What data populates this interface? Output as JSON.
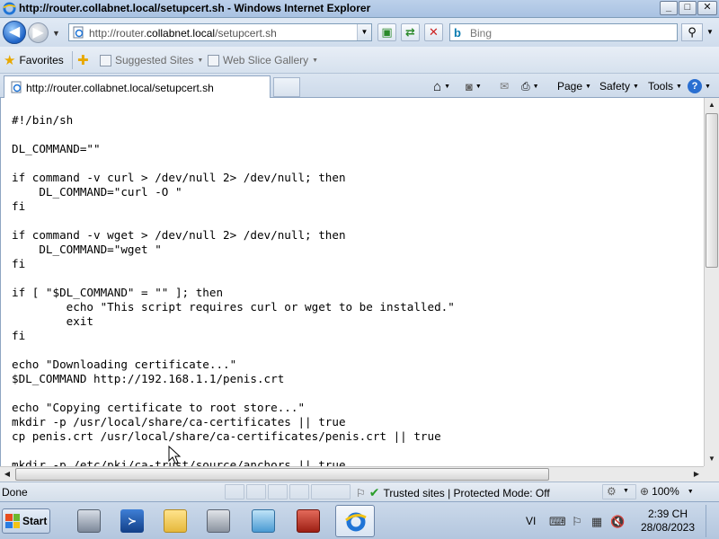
{
  "window": {
    "title": "http://router.collabnet.local/setupcert.sh - Windows Internet Explorer",
    "controls": {
      "minimize": "_",
      "maximize": "□",
      "close": "✕"
    }
  },
  "navigation": {
    "address_prefix": "http://router.",
    "address_domain": "collabnet.local",
    "address_suffix": "/setupcert.sh",
    "search_placeholder": "Bing"
  },
  "favorites_bar": {
    "favorites_label": "Favorites",
    "links": [
      {
        "label": "Suggested Sites"
      },
      {
        "label": "Web Slice Gallery"
      }
    ]
  },
  "tabs": [
    {
      "label": "http://router.collabnet.local/setupcert.sh",
      "active": true
    }
  ],
  "command_bar": {
    "page": "Page",
    "safety": "Safety",
    "tools": "Tools"
  },
  "document": {
    "lines": [
      "#!/bin/sh",
      "",
      "DL_COMMAND=\"\"",
      "",
      "if command -v curl > /dev/null 2> /dev/null; then",
      "    DL_COMMAND=\"curl -O \"",
      "fi",
      "",
      "if command -v wget > /dev/null 2> /dev/null; then",
      "    DL_COMMAND=\"wget \"",
      "fi",
      "",
      "if [ \"$DL_COMMAND\" = \"\" ]; then",
      "        echo \"This script requires curl or wget to be installed.\"",
      "        exit",
      "fi",
      "",
      "echo \"Downloading certificate...\"",
      "$DL_COMMAND http://192.168.1.1/penis.crt",
      "",
      "echo \"Copying certificate to root store...\"",
      "mkdir -p /usr/local/share/ca-certificates || true",
      "cp penis.crt /usr/local/share/ca-certificates/penis.crt || true",
      "",
      "mkdir -p /etc/pki/ca-trust/source/anchors || true"
    ]
  },
  "status_bar": {
    "status": "Done",
    "zone": "Trusted sites | Protected Mode: Off",
    "zoom": "100%"
  },
  "taskbar": {
    "start_label": "Start",
    "language": "VI",
    "time": "2:39 CH",
    "date": "28/08/2023",
    "apps": [
      {
        "icon": "server-manager-icon"
      },
      {
        "icon": "powershell-icon"
      },
      {
        "icon": "explorer-folder-icon"
      },
      {
        "icon": "admin-tools-icon"
      },
      {
        "icon": "control-panel-icon"
      },
      {
        "icon": "toolbox-icon"
      },
      {
        "icon": "internet-explorer-icon",
        "active": true
      }
    ]
  },
  "colors": {
    "accent": "#1e63c7",
    "chrome": "#cfdcec",
    "ie_blue": "#2a7de1",
    "ie_gold": "#f3c316"
  }
}
